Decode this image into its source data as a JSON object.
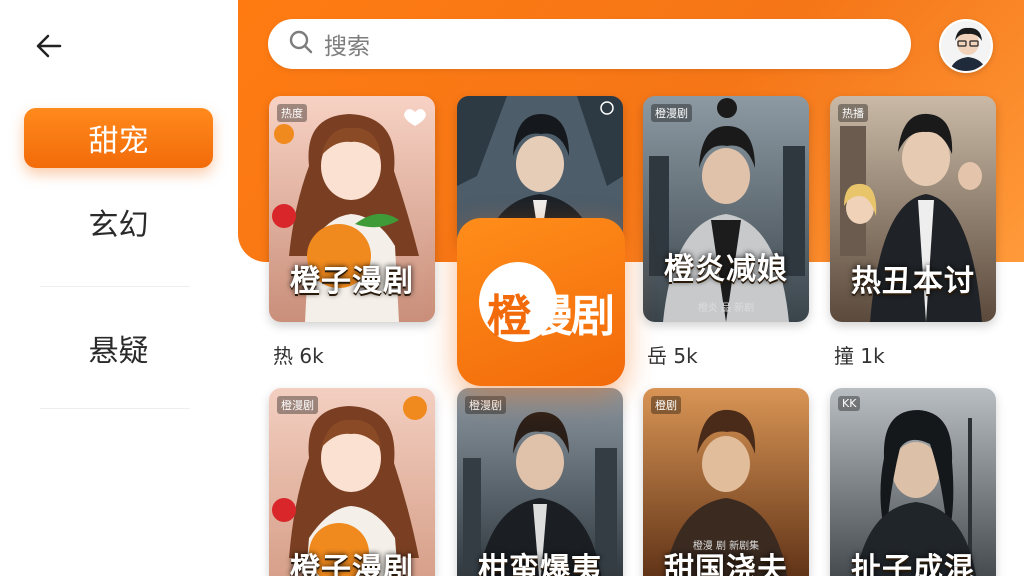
{
  "nav": {
    "categories": [
      {
        "label": "甜宠",
        "active": true
      },
      {
        "label": "玄幻",
        "active": false
      },
      {
        "label": "悬疑",
        "active": false
      }
    ]
  },
  "search": {
    "placeholder": "搜索"
  },
  "logo": {
    "part1": "橙",
    "part2": "漫剧"
  },
  "cards": [
    {
      "badge": "热度",
      "title": "橙子漫剧",
      "subtitle": "",
      "stat": "热 6k",
      "theme": "sweet"
    },
    {
      "badge": "",
      "title": "",
      "subtitle": "",
      "stat": "",
      "theme": "dark"
    },
    {
      "badge": "橙漫剧",
      "title": "橙炎减娘",
      "subtitle": "橙炎 品 新剧",
      "stat": "岳 5k",
      "theme": "city"
    },
    {
      "badge": "热播",
      "title": "热丑本讨",
      "subtitle": "",
      "stat": "撞 1k",
      "theme": "city2"
    },
    {
      "badge": "橙漫剧",
      "title": "橙子漫剧",
      "subtitle": "",
      "stat": "",
      "theme": "sweet"
    },
    {
      "badge": "橙漫剧",
      "title": "柑蛮爆夷",
      "subtitle": "",
      "stat": "",
      "theme": "dark"
    },
    {
      "badge": "橙剧",
      "title": "甜国浇夫",
      "subtitle": "橙漫 剧 新剧集",
      "stat": "",
      "theme": "fire"
    },
    {
      "badge": "KK",
      "title": "扯子成混",
      "subtitle": "",
      "stat": "",
      "theme": "storm"
    }
  ],
  "colors": {
    "accent": "#f57617",
    "accent_light": "#ff8a1c"
  },
  "icons": {
    "back": "arrow-left-icon",
    "search": "search-icon",
    "avatar": "user-avatar"
  }
}
